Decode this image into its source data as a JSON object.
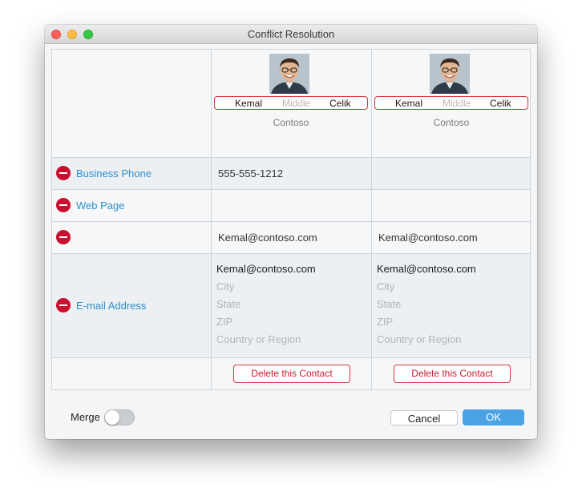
{
  "window": {
    "title": "Conflict Resolution"
  },
  "contacts": [
    {
      "first_name": "Kemal",
      "middle_placeholder": "Middle",
      "last_name": "Celik",
      "company": "Contoso",
      "business_phone": "555-555-1212",
      "web_page": "",
      "email_row": "Kemal@contoso.com",
      "address_email": "Kemal@contoso.com",
      "city_placeholder": "City",
      "state_placeholder": "State",
      "zip_placeholder": "ZIP",
      "country_placeholder": "Country or Region",
      "delete_label": "Delete this Contact"
    },
    {
      "first_name": "Kemal",
      "middle_placeholder": "Middle",
      "last_name": "Celik",
      "company": "Contoso",
      "business_phone": "",
      "web_page": "",
      "email_row": "Kemal@contoso.com",
      "address_email": "Kemal@contoso.com",
      "city_placeholder": "City",
      "state_placeholder": "State",
      "zip_placeholder": "ZIP",
      "country_placeholder": "Country or Region",
      "delete_label": "Delete this Contact"
    }
  ],
  "fields": {
    "business_phone": "Business Phone",
    "web_page": "Web Page",
    "email_row": "",
    "email_address": "E-mail Address"
  },
  "footer": {
    "merge_label": "Merge",
    "merge_on": false,
    "cancel_label": "Cancel",
    "ok_label": "OK"
  },
  "colors": {
    "accent": "#4ba2e4",
    "field_label": "#2d8fc9",
    "remove": "#c8102e",
    "delete_border": "#d0353a"
  }
}
